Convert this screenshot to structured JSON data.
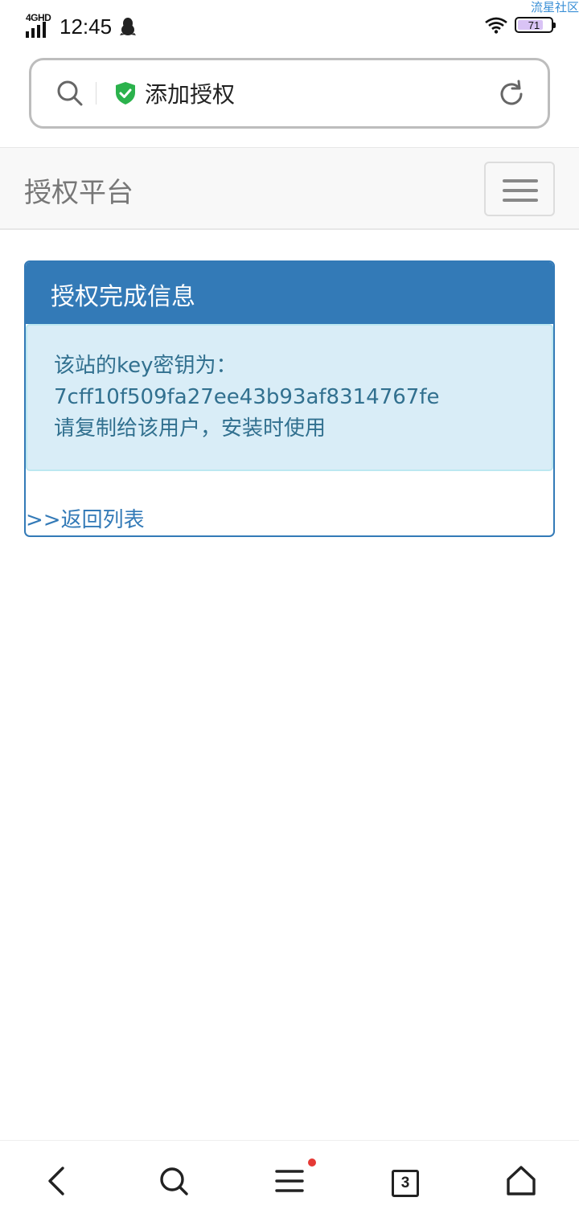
{
  "status_bar": {
    "network_label": "4GHD",
    "time": "12:45",
    "battery_level": "71",
    "watermark": "流星社区"
  },
  "address_bar": {
    "title": "添加授权"
  },
  "navbar": {
    "brand": "授权平台"
  },
  "panel": {
    "title": "授权完成信息",
    "alert_lines": [
      "该站的key密钥为：",
      "7cff10f509fa27ee43b93af8314767fe",
      "请复制给该用户，安装时使用"
    ],
    "back_link": ">>返回列表"
  },
  "toolbar": {
    "tab_count": "3",
    "menu_has_notification": true
  },
  "colors": {
    "primary": "#337ab7",
    "alert_bg": "#d9edf7",
    "alert_text": "#31708f",
    "shield_green": "#2bb24c",
    "notification_dot": "#e53935"
  }
}
